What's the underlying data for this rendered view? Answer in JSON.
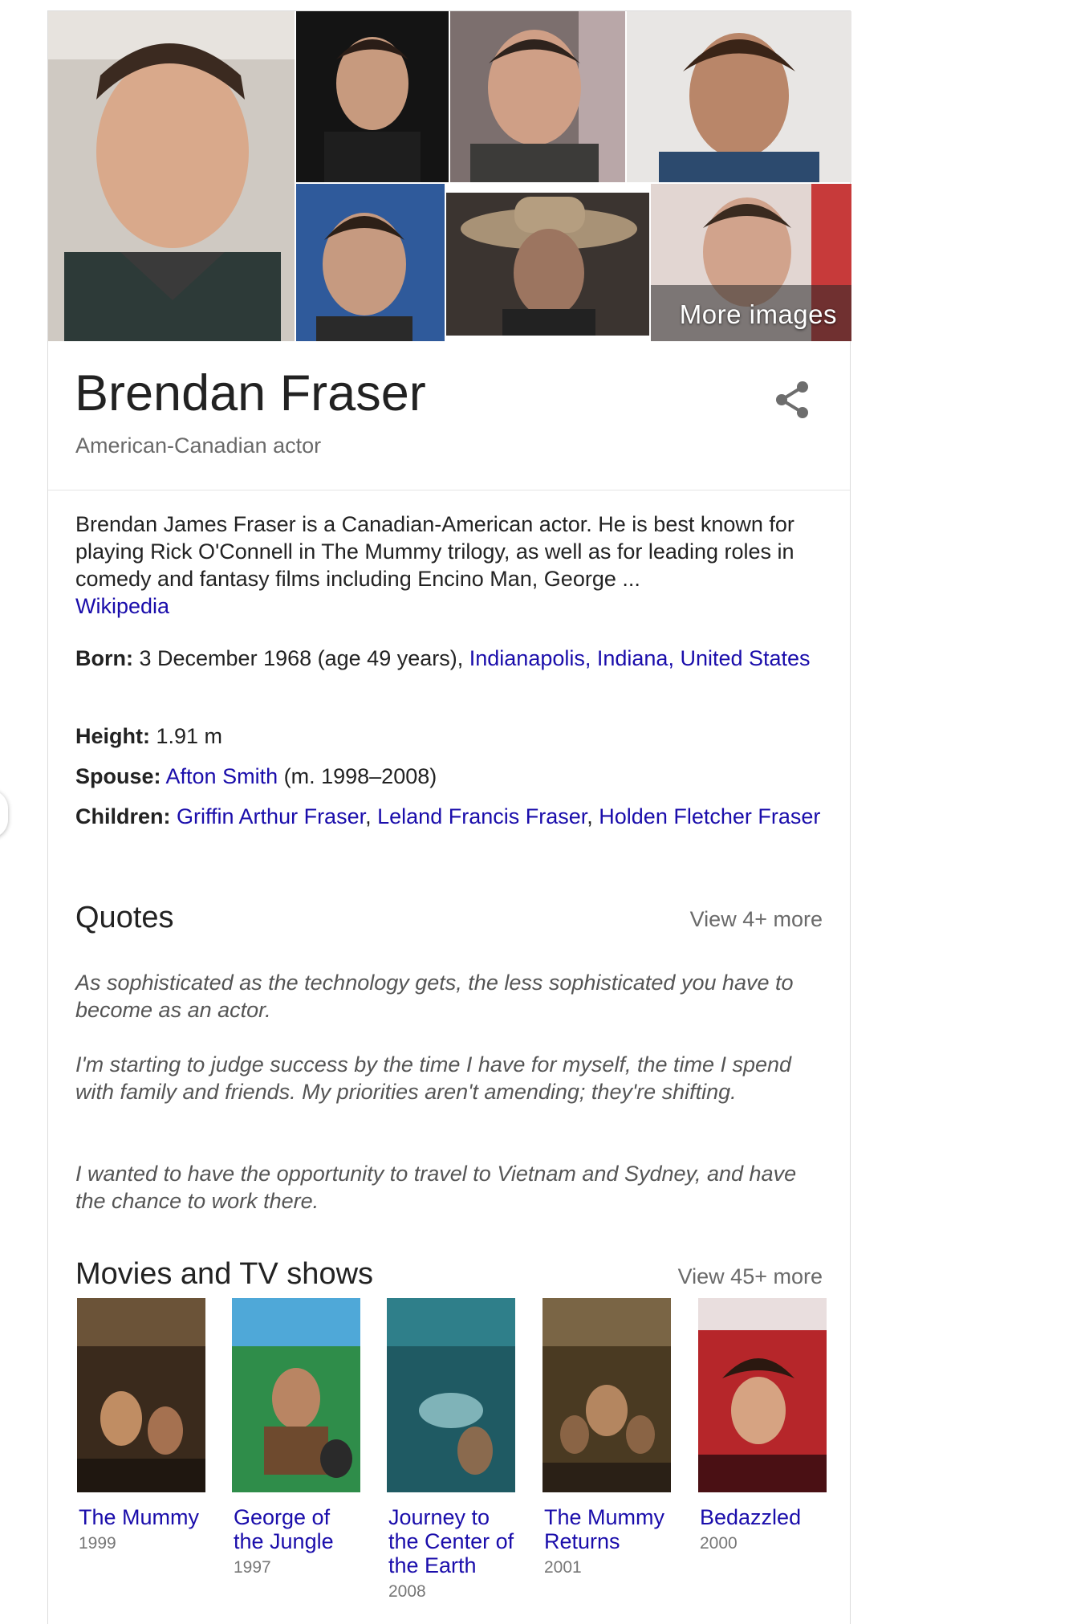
{
  "panel": {
    "more_images_label": "More images",
    "name": "Brendan Fraser",
    "subtitle": "American-Canadian actor",
    "description": "Brendan James Fraser is a Canadian-American actor. He is best known for playing Rick O'Connell in The Mummy trilogy, as well as for leading roles in comedy and fantasy films including Encino Man, George ...",
    "source_link": "Wikipedia"
  },
  "facts": {
    "born_label": "Born:",
    "born_value": "3 December 1968 (age 49 years),",
    "born_place_link": "Indianapolis, Indiana, United States",
    "height_label": "Height:",
    "height_value": "1.91 m",
    "spouse_label": "Spouse:",
    "spouse_link": "Afton Smith",
    "spouse_years": "(m. 1998–2008)",
    "children_label": "Children:",
    "children": [
      "Griffin Arthur Fraser",
      "Leland Francis Fraser",
      "Holden Fletcher Fraser"
    ],
    "children_separator": ","
  },
  "quotes": {
    "title": "Quotes",
    "view_more": "View 4+ more",
    "items": [
      "As sophisticated as the technology gets, the less sophisticated you have to become as an actor.",
      "I'm starting to judge success by the time I have for myself, the time I spend with family and friends. My priorities aren't amending; they're shifting.",
      "I wanted to have the opportunity to travel to Vietnam and Sydney, and have the chance to work there."
    ]
  },
  "movies": {
    "title": "Movies and TV shows",
    "view_more": "View 45+ more",
    "items": [
      {
        "title": "The Mummy",
        "year": "1999"
      },
      {
        "title": "George of the Jungle",
        "year": "1997"
      },
      {
        "title": "Journey to the Center of the Earth",
        "year": "2008"
      },
      {
        "title": "The Mummy Returns",
        "year": "2001"
      },
      {
        "title": "Bedazzled",
        "year": "2000"
      }
    ]
  },
  "colors": {
    "link": "#1a0dab",
    "muted": "#6a6a6a",
    "text": "#222222"
  }
}
